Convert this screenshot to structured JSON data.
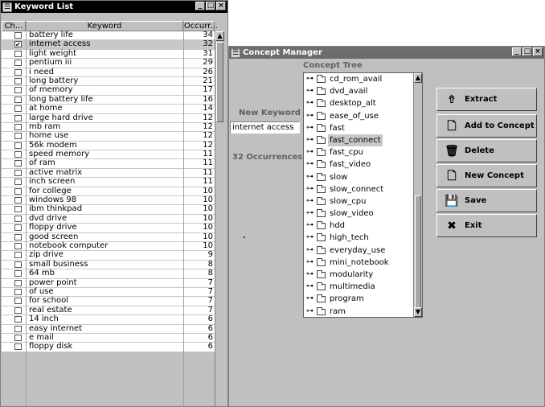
{
  "keyword_list": {
    "title": "Keyword List",
    "columns": {
      "check": "Ch...",
      "keyword": "Keyword",
      "occurrences": "Occurr..."
    },
    "rows": [
      {
        "checked": false,
        "keyword": "battery life",
        "count": "34"
      },
      {
        "checked": true,
        "keyword": "internet access",
        "count": "32"
      },
      {
        "checked": false,
        "keyword": "light weight",
        "count": "31"
      },
      {
        "checked": false,
        "keyword": "pentium iii",
        "count": "29"
      },
      {
        "checked": false,
        "keyword": "i need",
        "count": "26"
      },
      {
        "checked": false,
        "keyword": "long battery",
        "count": "21"
      },
      {
        "checked": false,
        "keyword": "of memory",
        "count": "17"
      },
      {
        "checked": false,
        "keyword": "long battery life",
        "count": "16"
      },
      {
        "checked": false,
        "keyword": "at home",
        "count": "14"
      },
      {
        "checked": false,
        "keyword": "large hard drive",
        "count": "12"
      },
      {
        "checked": false,
        "keyword": "mb ram",
        "count": "12"
      },
      {
        "checked": false,
        "keyword": "home use",
        "count": "12"
      },
      {
        "checked": false,
        "keyword": "56k modem",
        "count": "12"
      },
      {
        "checked": false,
        "keyword": "speed memory",
        "count": "11"
      },
      {
        "checked": false,
        "keyword": "of ram",
        "count": "11"
      },
      {
        "checked": false,
        "keyword": "active matrix",
        "count": "11"
      },
      {
        "checked": false,
        "keyword": "inch screen",
        "count": "11"
      },
      {
        "checked": false,
        "keyword": "for college",
        "count": "10"
      },
      {
        "checked": false,
        "keyword": "windows 98",
        "count": "10"
      },
      {
        "checked": false,
        "keyword": "ibm thinkpad",
        "count": "10"
      },
      {
        "checked": false,
        "keyword": "dvd drive",
        "count": "10"
      },
      {
        "checked": false,
        "keyword": "floppy drive",
        "count": "10"
      },
      {
        "checked": false,
        "keyword": "good screen",
        "count": "10"
      },
      {
        "checked": false,
        "keyword": "notebook computer",
        "count": "10"
      },
      {
        "checked": false,
        "keyword": "zip drive",
        "count": "9"
      },
      {
        "checked": false,
        "keyword": "small business",
        "count": "8"
      },
      {
        "checked": false,
        "keyword": "64 mb",
        "count": "8"
      },
      {
        "checked": false,
        "keyword": "power point",
        "count": "7"
      },
      {
        "checked": false,
        "keyword": "of use",
        "count": "7"
      },
      {
        "checked": false,
        "keyword": "for school",
        "count": "7"
      },
      {
        "checked": false,
        "keyword": "real estate",
        "count": "7"
      },
      {
        "checked": false,
        "keyword": "14 inch",
        "count": "6"
      },
      {
        "checked": false,
        "keyword": "easy internet",
        "count": "6"
      },
      {
        "checked": false,
        "keyword": "e mail",
        "count": "6"
      },
      {
        "checked": false,
        "keyword": "floppy disk",
        "count": "6"
      }
    ]
  },
  "concept_manager": {
    "title": "Concept Manager",
    "tree_label": "Concept Tree",
    "new_keyword_label": "New Keyword",
    "new_keyword_value": "internet access",
    "occurrences_text": "32 Occurrences",
    "concepts": [
      "cd_rom_avail",
      "dvd_avail",
      "desktop_alt",
      "ease_of_use",
      "fast",
      "fast_connect",
      "fast_cpu",
      "fast_video",
      "slow",
      "slow_connect",
      "slow_cpu",
      "slow_video",
      "hdd",
      "high_tech",
      "everyday_use",
      "mini_notebook",
      "modularity",
      "multimedia",
      "program",
      "ram"
    ],
    "selected_concept": "fast_connect",
    "buttons": [
      {
        "label": "Extract",
        "icon": "extract-icon"
      },
      {
        "label": "Add to Concept",
        "icon": "add-document-icon"
      },
      {
        "label": "Delete",
        "icon": "trash-icon"
      },
      {
        "label": "New Concept",
        "icon": "new-document-icon"
      },
      {
        "label": "Save",
        "icon": "floppy-disk-icon"
      },
      {
        "label": "Exit",
        "icon": "exit-x-icon"
      }
    ]
  },
  "colors": {
    "selection": "#c8c8c8",
    "window_bg": "#c0c0c0",
    "active_title": "#000000",
    "inactive_title": "#6e6e6e"
  }
}
